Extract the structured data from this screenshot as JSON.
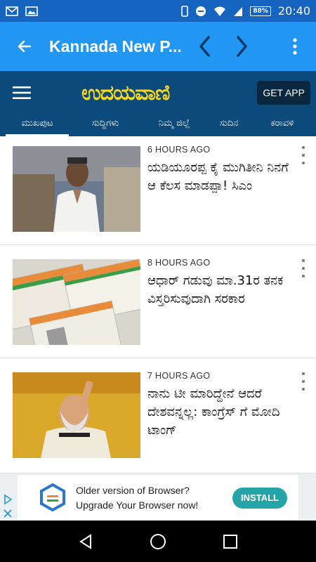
{
  "status_bar": {
    "time": "20:40",
    "battery": "88%",
    "icons": [
      "gmail-icon",
      "photo-icon",
      "phone-icon",
      "do-not-disturb-icon",
      "wifi-icon",
      "signal-icon"
    ]
  },
  "app_bar": {
    "title": "Kannada New P...",
    "color": "#2196f3",
    "back_icon": "arrow-left-icon",
    "prev_icon": "chevron-left-icon",
    "next_icon": "chevron-right-icon",
    "menu_icon": "more-vert-icon"
  },
  "site_header": {
    "logo_text": "ಉದಯವಾಣಿ",
    "get_app_label": "GET APP",
    "bg_color": "#0b4a7a",
    "logo_color": "#f9d71c"
  },
  "tabs": [
    {
      "label": "ಮುಖಪುಟ",
      "active": true
    },
    {
      "label": "ಸುದ್ದಿಗಳು",
      "active": false
    },
    {
      "label": "ನಿಮ್ಮ ಜಿಲ್ಲೆ",
      "active": false
    },
    {
      "label": "ಸುದಿನ",
      "active": false
    },
    {
      "label": "ಕರಾವಳಿ",
      "active": false
    }
  ],
  "articles": [
    {
      "time": "6 HOURS AGO",
      "title": "ಯಡಿಯೂರಪ್ಪ ಕೈ ಮುಗಿತೀನಿ ನಿನಗೆ ಆ ಕೆಲಸ ಮಾಡಪ್ಪಾ! ಸಿಎಂ"
    },
    {
      "time": "8 HOURS AGO",
      "title": "ಆಧಾರ್ ಗಡುವು ಮಾ.31ರ ತನಕ ವಿಸ್ತರಿಸುವುದಾಗಿ ಸರಕಾರ"
    },
    {
      "time": "7 HOURS AGO",
      "title": "ನಾನು ಟೀ ಮಾರಿದ್ದೇನೆ ಆದರೆ ದೇಶವನ್ನಲ್ಲ: ಕಾಂಗ್ರೆಸ್ ಗೆ ಮೋದಿ ಟಾಂಗ್"
    }
  ],
  "ad": {
    "line1": "Older version of Browser?",
    "line2": "Upgrade Your Browser now!",
    "install_label": "INSTALL",
    "install_color": "#26a5a8"
  },
  "nav_bar": {
    "back_icon": "nav-back-icon",
    "home_icon": "nav-home-icon",
    "recents_icon": "nav-recents-icon"
  }
}
